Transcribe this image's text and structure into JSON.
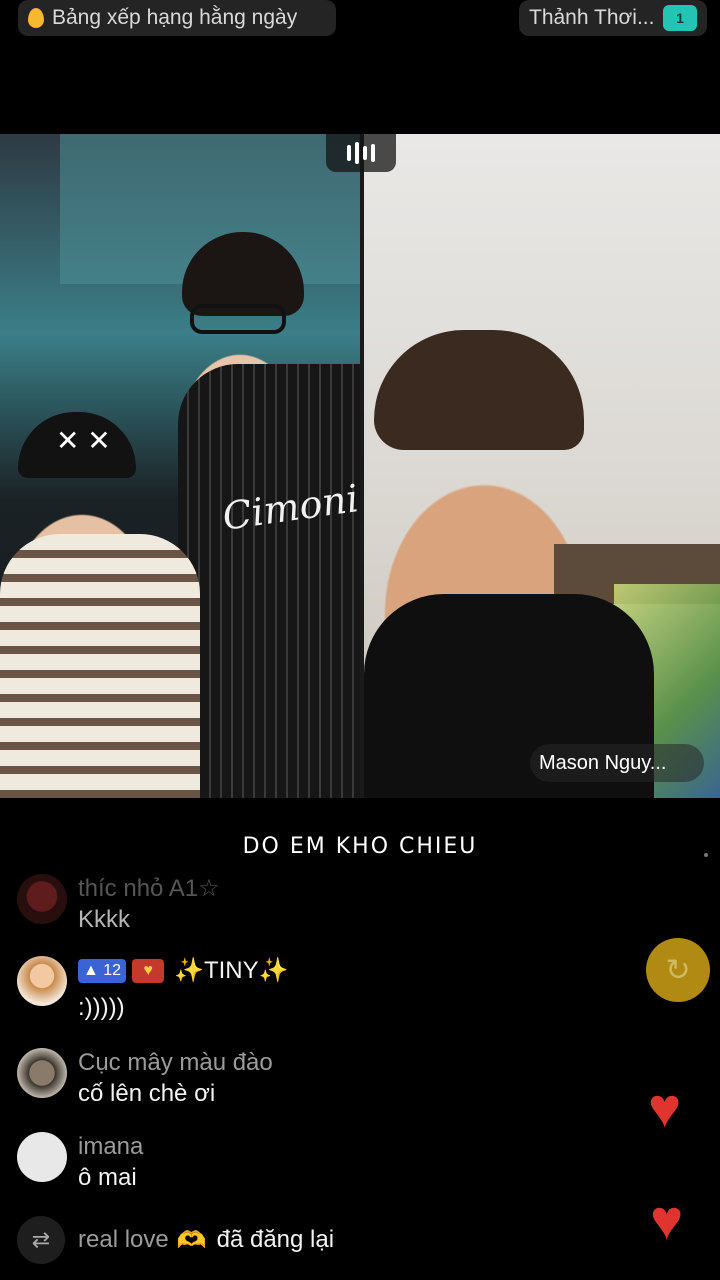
{
  "header": {
    "ranking_label": "Bảng xếp hạng hằng ngày",
    "host_label": "Thảnh Thơi...",
    "host_badge": "1"
  },
  "video": {
    "right_name": "Mason Nguy...",
    "jersey_script": "Cimonic"
  },
  "caption": "DO EM KHO CHIEU",
  "comments": [
    {
      "user": "thíc nhỏ A1☆",
      "text": "Kkkk"
    },
    {
      "user": "✨TINY✨",
      "level": "12",
      "text": ":)))))"
    },
    {
      "user": "Cục mây màu đào",
      "text": "cố lên chè ơi"
    },
    {
      "user": "imana",
      "text": "ô mai"
    }
  ],
  "repost": {
    "user": "real love",
    "emoji": "🫶",
    "action": "đã đăng lại"
  },
  "icons": {
    "share": "↻",
    "heart": "♥",
    "repost": "⇄"
  },
  "colors": {
    "heart": "#e0352f",
    "share_button": "#c49a15",
    "level_badge": "#3a63d6"
  }
}
